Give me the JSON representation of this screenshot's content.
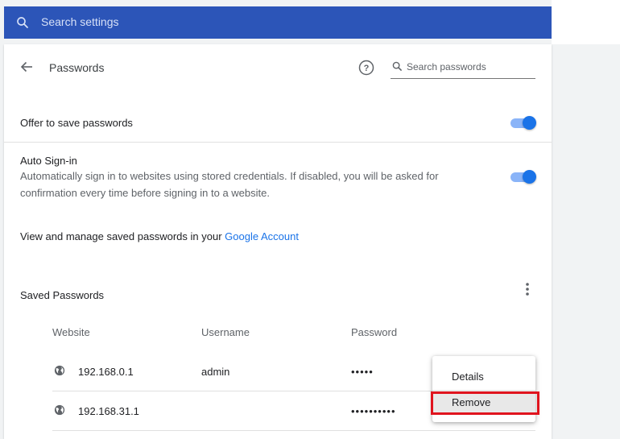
{
  "search_settings": {
    "placeholder": "Search settings"
  },
  "header": {
    "title": "Passwords",
    "search_placeholder": "Search passwords"
  },
  "offer_to_save": {
    "label": "Offer to save passwords",
    "enabled": true
  },
  "auto_signin": {
    "label": "Auto Sign-in",
    "description_line1": "Automatically sign in to websites using stored credentials. If disabled, you will be asked for",
    "description_line2": "confirmation every time before signing in to a website.",
    "enabled": true
  },
  "manage": {
    "text": "View and manage saved passwords in your ",
    "link": "Google Account"
  },
  "saved_passwords": {
    "title": "Saved Passwords",
    "columns": [
      "Website",
      "Username",
      "Password"
    ],
    "rows": [
      {
        "website": "192.168.0.1",
        "username": "admin",
        "password": "•••••"
      },
      {
        "website": "192.168.31.1",
        "username": "",
        "password": "••••••••••"
      }
    ]
  },
  "context_menu": {
    "items": [
      "Details",
      "Remove"
    ]
  },
  "colors": {
    "search_bar": "#2c55b8",
    "accent": "#1a73e8",
    "highlight": "#e0141e"
  }
}
